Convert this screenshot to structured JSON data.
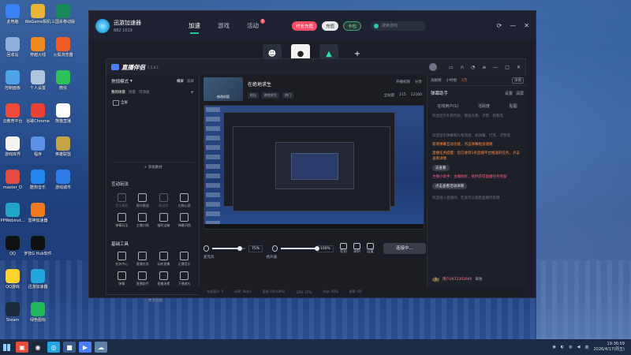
{
  "desktop": {
    "column1": [
      {
        "label": "此电脑",
        "icon": "computer-icon",
        "color": "#3b82f6"
      },
      {
        "label": "回收站",
        "icon": "recycle-bin-icon",
        "color": "#8fb0d8"
      },
      {
        "label": "控制面板",
        "icon": "control-panel-icon",
        "color": "#4ca3e8"
      },
      {
        "label": "云教育平台",
        "icon": "cloud-education-icon",
        "color": "#f04a3a"
      },
      {
        "label": "游戏库界",
        "icon": "game-library-icon",
        "color": "#f5f5f5"
      },
      {
        "label": "master_D",
        "icon": "master-d-icon",
        "color": "#e34b3c"
      },
      {
        "label": "PPWebinst...",
        "icon": "pp-web-icon",
        "color": "#22a6c7"
      },
      {
        "label": "QQ",
        "icon": "qq-icon",
        "color": "#111111"
      },
      {
        "label": "QQ游戏",
        "icon": "qq-game-icon",
        "color": "#ffd22e"
      },
      {
        "label": "Steam",
        "icon": "steam-icon",
        "color": "#1b2838"
      }
    ],
    "column2": [
      {
        "label": "WeGame相机",
        "icon": "wegame-icon",
        "color": "#e8b437"
      },
      {
        "label": "穿越火线",
        "icon": "crossfire-icon",
        "color": "#f08a1c"
      },
      {
        "label": "个人设置",
        "icon": "personal-settings-icon",
        "color": "#b0c4de"
      },
      {
        "label": "谷歌Chrome",
        "icon": "chrome-icon",
        "color": "#e94235"
      },
      {
        "label": "程序",
        "icon": "program-icon",
        "color": "#5b8fe8"
      },
      {
        "label": "酷狗音乐",
        "icon": "kugou-icon",
        "color": "#2389ee"
      },
      {
        "label": "雷神加速器",
        "icon": "leishen-icon",
        "color": "#f07b1c"
      },
      {
        "label": "罗技G Hub软件",
        "icon": "logitech-icon",
        "color": "#101010"
      },
      {
        "label": "迅游加速器",
        "icon": "xunyou-icon",
        "color": "#22a6e0"
      },
      {
        "label": "绿色图标",
        "icon": "green-app-icon",
        "color": "#1fb95a"
      }
    ],
    "column3": [
      {
        "label": "三国杀移动版",
        "icon": "sanguosha-icon",
        "color": "#1a8a58"
      },
      {
        "label": "火狐浏览器",
        "icon": "firefox-icon",
        "color": "#f05b2a"
      },
      {
        "label": "微信",
        "icon": "wechat-icon",
        "color": "#2bc25a"
      },
      {
        "label": "熊猫直播",
        "icon": "panda-icon",
        "color": "#ffffff"
      },
      {
        "label": "英雄联盟",
        "icon": "lol-icon",
        "color": "#c7a44b"
      },
      {
        "label": "游戏城市",
        "icon": "game-city-icon",
        "color": "#2e7de8"
      }
    ]
  },
  "accelerator": {
    "title": "迅游加速器",
    "user_id": "682 1019",
    "tabs": [
      {
        "label": "加速",
        "active": true
      },
      {
        "label": "游戏",
        "active": false
      },
      {
        "label": "活动",
        "active": false,
        "badge": "5"
      }
    ],
    "pills": {
      "vip": "时长充值",
      "recharge": "充值",
      "card": "卡包"
    },
    "search_placeholder": "搜索游戏",
    "accent": "#21c2a7"
  },
  "live": {
    "brand": "直播伴侣",
    "version": "5.5.8.1",
    "mode": "常规模式",
    "mode_toggle": [
      "横屏",
      "竖屏"
    ],
    "scene_tabs": [
      "我的场景",
      "场景",
      "可添加"
    ],
    "scene_item": "全屏",
    "add_source": "添加素材",
    "interact_title": "互动玩法",
    "interact_tools": [
      {
        "label": "音乐播放",
        "dim": true
      },
      {
        "label": "观众挑战",
        "dim": false
      },
      {
        "label": "粉丝团",
        "dim": true
      },
      {
        "label": "礼物心愿",
        "dim": false
      },
      {
        "label": "弹幕玩法",
        "dim": false
      },
      {
        "label": "主播口袋",
        "dim": false
      },
      {
        "label": "福利宝箱",
        "dim": false
      },
      {
        "label": "弹幕词频",
        "dim": false
      }
    ],
    "basic_title": "基础工具",
    "basic_tools": [
      {
        "label": "任务中心",
        "dim": false
      },
      {
        "label": "直播任务",
        "dim": false
      },
      {
        "label": "玩转直播",
        "dim": false
      },
      {
        "label": "正播音乐",
        "dim": false
      },
      {
        "label": "弹幕",
        "dim": false
      },
      {
        "label": "直播助手",
        "dim": false
      },
      {
        "label": "直播场景",
        "dim": false
      },
      {
        "label": "下播收礼",
        "dim": false
      }
    ],
    "more_func": "更多功能",
    "stream": {
      "cover_label": "修改封面",
      "title": "在绝地求生",
      "tags": [
        "射击",
        "绝地求生",
        "热门"
      ],
      "btn_open": "开播权限",
      "btn_share": "分享",
      "stats": [
        "全站第",
        "215",
        "12160"
      ]
    },
    "audio": {
      "mic_label": "麦克风",
      "mic_volume": "75%",
      "mic_value": 0.75,
      "spk_label": "扬声器",
      "spk_volume": "100%",
      "spk_value": 1.0,
      "btn1": "装扮",
      "btn2": "录制",
      "btn3": "设置",
      "connect": "连接中..."
    },
    "status": [
      "在线观众: 0",
      "码率: 0kb/s",
      "丢帧: 0(0.00%)",
      "CPU: 37%",
      "内存: 40%",
      "帧率: 60"
    ],
    "right": {
      "header": [
        "贡献榜",
        "小时榜",
        "2万",
        "详情"
      ],
      "section_title": "弹幕助手",
      "section_ctrl": [
        "设置",
        "清屏"
      ],
      "tabs": [
        "在线用户(1)",
        "活跃度",
        "贴图"
      ],
      "texts": [
        "欢迎显示礼物列表，赠送头像、点赞、观看等",
        "欢迎显示弹幕和礼物消息，如弹幕、打赏、点赞等"
      ],
      "orange": [
        "新增弹幕互动功能，点击弹幕框加速跳",
        "直播任务提醒：您已收到1条直播平台推送的任务，点击查看详情"
      ],
      "pill1": "去查看",
      "pink": [
        "主播小助手：主播你好，依然获得直播任务奖励",
        "点击查看活动详情"
      ],
      "pill2": "点击查看活动详情",
      "gray_tail": "欢迎进入直播间，在此可以观看直播内容哦",
      "user": {
        "level": "1",
        "name": "用户2672302695",
        "action": "来啦"
      }
    }
  },
  "taskbar": {
    "time": "19:36:59",
    "date": "2026/4/17(周五)",
    "lang": "英"
  }
}
